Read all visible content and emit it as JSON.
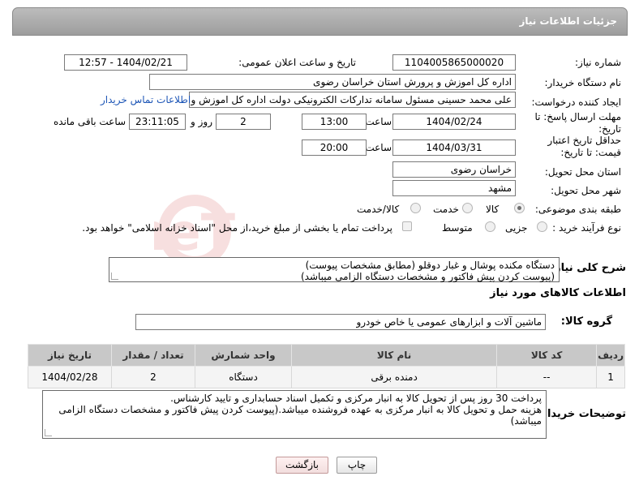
{
  "header": {
    "title": "جزئیات اطلاعات نیاز"
  },
  "fields": {
    "need_number_label": "شماره نیاز:",
    "need_number": "1104005865000020",
    "announce_label": "تاریخ و ساعت اعلان عمومی:",
    "announce_value": "1404/02/21 - 12:57",
    "buyer_org_label": "نام دستگاه خریدار:",
    "buyer_org": "اداره کل اموزش و پرورش استان خراسان رضوی",
    "requester_label": "ایجاد کننده درخواست:",
    "requester": "علی محمد حسینی مسئول سامانه تدارکات الکترونیکی دولت اداره کل اموزش و",
    "contact_link": "اطلاعات تماس خریدار",
    "deadline_label": "مهلت ارسال پاسخ: تا تاریخ:",
    "deadline_date": "1404/02/24",
    "time_label": "ساعت",
    "deadline_time": "13:00",
    "days_value": "2",
    "days_label": "روز و",
    "remaining_time": "23:11:05",
    "remaining_label": "ساعت باقی مانده",
    "validity_label": "حداقل تاریخ اعتبار قیمت: تا تاریخ:",
    "validity_date": "1404/03/31",
    "validity_time": "20:00",
    "province_label": "استان محل تحویل:",
    "province": "خراسان رضوی",
    "city_label": "شهر محل تحویل:",
    "city": "مشهد",
    "category_label": "طبقه بندی موضوعی:",
    "category_options": [
      "کالا",
      "خدمت",
      "کالا/خدمت"
    ],
    "process_label": "نوع فرآیند خرید :",
    "process_options": [
      "جزیی",
      "متوسط"
    ],
    "payment_note": "پرداخت تمام یا بخشی از مبلغ خرید،از محل \"اسناد خزانه اسلامی\" خواهد بود.",
    "description_label": "شرح کلی نیاز:",
    "description_lines": [
      "دستگاه مکنده پوشال و غبار دوقلو (مطابق مشخصات پیوست)",
      "(پیوست کردن پیش فاکتور و مشخصات دستگاه الزامی میباشد)"
    ]
  },
  "goods": {
    "section_title": "اطلاعات کالاهای مورد نیاز",
    "group_label": "گروه کالا:",
    "group_value": "ماشین آلات و ابزارهای عمومی یا خاص خودرو",
    "columns": [
      "ردیف",
      "کد کالا",
      "نام کالا",
      "واحد شمارش",
      "تعداد / مقدار",
      "تاریخ نیاز"
    ],
    "rows": [
      [
        "1",
        "--",
        "دمنده برقی",
        "دستگاه",
        "2",
        "1404/02/28"
      ]
    ]
  },
  "buyer_notes": {
    "label": "توضیحات خریدار:",
    "lines": [
      "پرداخت 30 روز پس از تحویل کالا به انبار مرکزی و تکمیل اسناد حسابداری و تایید کارشناس.",
      "هزینه حمل و تحویل کالا به انبار مرکزی به عهده فروشنده میباشد.(پیوست کردن پیش فاکتور و مشخصات دستگاه الزامی",
      "میباشد)"
    ]
  },
  "buttons": {
    "print": "چاپ",
    "back": "بازگشت"
  },
  "watermark": "AriaTender.neT",
  "colors": {
    "header_bg": "#a9a9a9",
    "link": "#1c55b6",
    "table_header": "#c8c8c8"
  }
}
